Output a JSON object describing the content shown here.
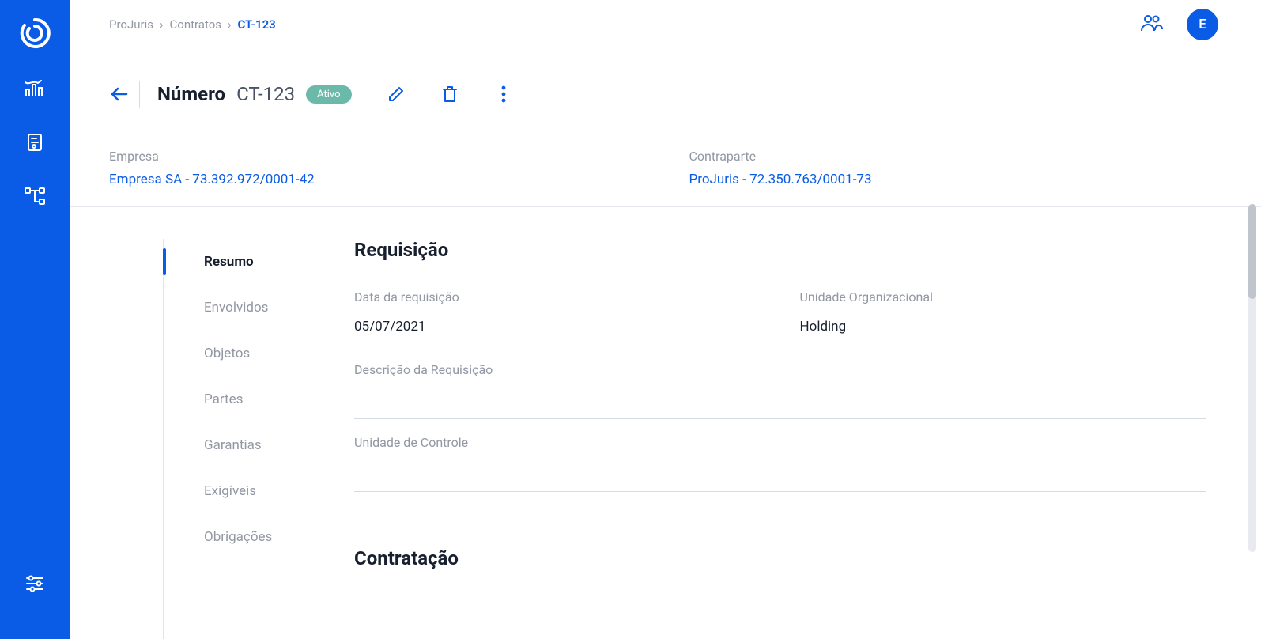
{
  "breadcrumb": {
    "a": "ProJuris",
    "b": "Contratos",
    "current": "CT-123"
  },
  "avatar_initial": "E",
  "header": {
    "label": "Número",
    "value": "CT-123",
    "status": "Ativo"
  },
  "entities": {
    "empresa_label": "Empresa",
    "empresa_value": "Empresa SA - 73.392.972/0001-42",
    "contraparte_label": "Contraparte",
    "contraparte_value": "ProJuris - 72.350.763/0001-73"
  },
  "menu": {
    "items": [
      "Resumo",
      "Envolvidos",
      "Objetos",
      "Partes",
      "Garantias",
      "Exigíveis",
      "Obrigações"
    ]
  },
  "sections": {
    "requisicao_title": "Requisição",
    "contratacao_title": "Contratação"
  },
  "fields": {
    "data_req_label": "Data da requisição",
    "data_req_value": "05/07/2021",
    "unidade_org_label": "Unidade Organizacional",
    "unidade_org_value": "Holding",
    "descricao_label": "Descrição da Requisição",
    "descricao_value": "",
    "unidade_controle_label": "Unidade de Controle",
    "unidade_controle_value": ""
  }
}
